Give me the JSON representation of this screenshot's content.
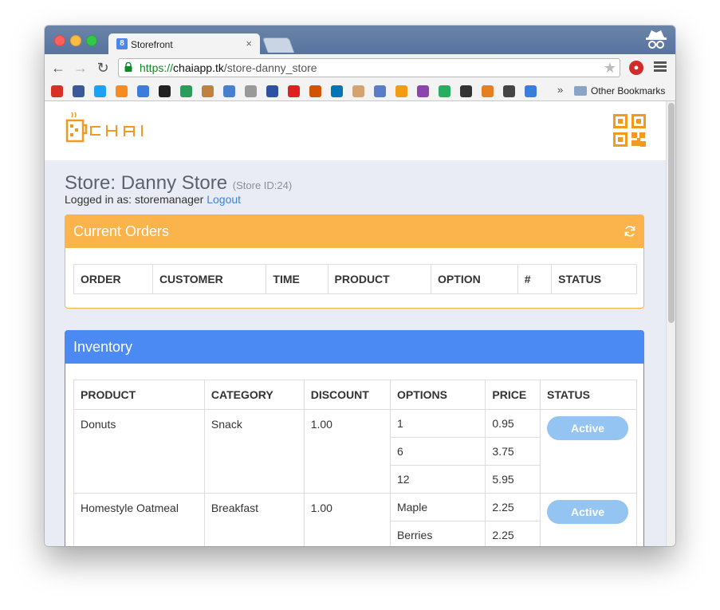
{
  "browser": {
    "tab_title": "Storefront",
    "tab_favicon": "8",
    "close_glyph": "×",
    "url_scheme": "https://",
    "url_host": "chaiapp.tk",
    "url_path": "/store-danny_store",
    "nav": {
      "back": "←",
      "forward": "→",
      "reload": "↻"
    },
    "star_glyph": "★",
    "ext_glyph": "●",
    "bookmarks_more": "»",
    "other_bookmarks": "Other Bookmarks",
    "bookmark_icons": [
      "gmail-icon",
      "facebook-icon",
      "twitter-icon",
      "crunchyroll-icon",
      "cloud-icon",
      "yin-yang-icon",
      "drive-icon",
      "avatar-icon",
      "dots-icon",
      "stack-icon",
      "mal-icon",
      "youtube-icon",
      "pe-icon",
      "linkedin-icon",
      "thumbs-up-icon",
      "globe-icon",
      "chrome-icon",
      "peace-icon",
      "puzzle-icon",
      "k-icon",
      "pixel-face-icon",
      "tv-icon",
      "info-icon"
    ]
  },
  "colors": {
    "orange": "#fbb44b",
    "blue": "#4a8af2",
    "link": "#3f83d6",
    "status_btn": "#94c5f2"
  },
  "store": {
    "title": "Store: Danny Store",
    "id_label": "(Store ID:24)",
    "logged_in_label": "Logged in as: storemanager",
    "logout": "Logout"
  },
  "orders": {
    "title": "Current Orders",
    "columns": [
      "ORDER",
      "CUSTOMER",
      "TIME",
      "PRODUCT",
      "OPTION",
      "#",
      "STATUS"
    ]
  },
  "inventory": {
    "title": "Inventory",
    "columns": [
      "PRODUCT",
      "CATEGORY",
      "DISCOUNT",
      "OPTIONS",
      "PRICE",
      "STATUS"
    ],
    "rows": [
      {
        "product": "Donuts",
        "category": "Snack",
        "discount": "1.00",
        "options": [
          {
            "name": "1",
            "price": "0.95"
          },
          {
            "name": "6",
            "price": "3.75"
          },
          {
            "name": "12",
            "price": "5.95"
          }
        ],
        "status": "Active"
      },
      {
        "product": "Homestyle Oatmeal",
        "category": "Breakfast",
        "discount": "1.00",
        "options": [
          {
            "name": "Maple",
            "price": "2.25"
          },
          {
            "name": "Berries",
            "price": "2.25"
          }
        ],
        "status": "Active"
      }
    ]
  }
}
